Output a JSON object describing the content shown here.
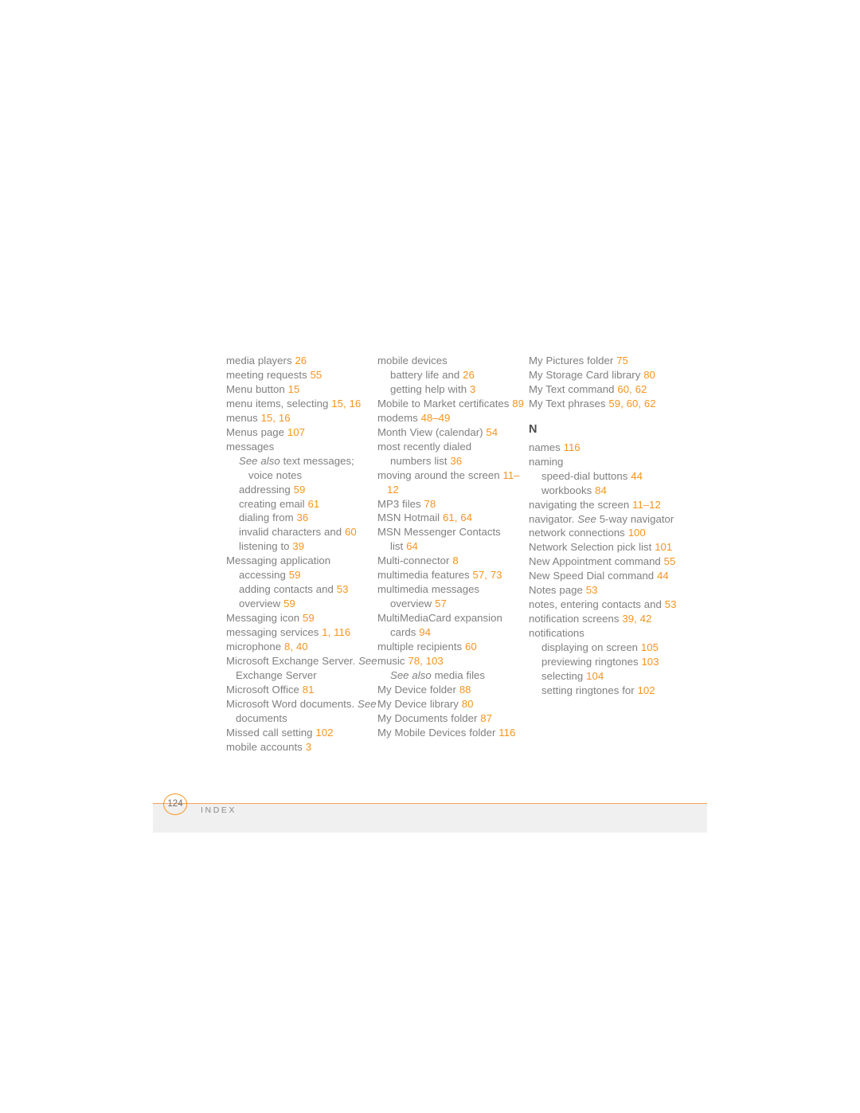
{
  "page": {
    "footer": {
      "page_number": "124",
      "section_label": "INDEX",
      "rule_color": "#F7A35C",
      "band_color": "#f0f0f0"
    },
    "colors": {
      "body_text": "#808080",
      "page_number_accent": "#F7941E",
      "heading": "#4d4d4d"
    }
  },
  "columns": [
    {
      "id": "column-1",
      "entries": [
        {
          "level": 0,
          "parts": [
            {
              "t": "media players ",
              "k": "text"
            },
            {
              "t": "26",
              "k": "num"
            }
          ]
        },
        {
          "level": 0,
          "parts": [
            {
              "t": "meeting requests ",
              "k": "text"
            },
            {
              "t": "55",
              "k": "num"
            }
          ]
        },
        {
          "level": 0,
          "parts": [
            {
              "t": "Menu button ",
              "k": "text"
            },
            {
              "t": "15",
              "k": "num"
            }
          ]
        },
        {
          "level": 0,
          "parts": [
            {
              "t": "menu items, selecting ",
              "k": "text"
            },
            {
              "t": "15, 16",
              "k": "num"
            }
          ]
        },
        {
          "level": 0,
          "parts": [
            {
              "t": "menus ",
              "k": "text"
            },
            {
              "t": "15, 16",
              "k": "num"
            }
          ]
        },
        {
          "level": 0,
          "parts": [
            {
              "t": "Menus page ",
              "k": "text"
            },
            {
              "t": "107",
              "k": "num"
            }
          ]
        },
        {
          "level": 0,
          "parts": [
            {
              "t": "messages",
              "k": "text"
            }
          ]
        },
        {
          "level": 1,
          "parts": [
            {
              "t": "See also",
              "k": "ital"
            },
            {
              "t": " text messages;",
              "k": "text"
            }
          ]
        },
        {
          "level": 2,
          "parts": [
            {
              "t": "voice notes",
              "k": "text"
            }
          ]
        },
        {
          "level": 1,
          "parts": [
            {
              "t": "addressing ",
              "k": "text"
            },
            {
              "t": "59",
              "k": "num"
            }
          ]
        },
        {
          "level": 1,
          "parts": [
            {
              "t": "creating email ",
              "k": "text"
            },
            {
              "t": "61",
              "k": "num"
            }
          ]
        },
        {
          "level": 1,
          "parts": [
            {
              "t": "dialing from ",
              "k": "text"
            },
            {
              "t": "36",
              "k": "num"
            }
          ]
        },
        {
          "level": 1,
          "parts": [
            {
              "t": "invalid characters and ",
              "k": "text"
            },
            {
              "t": "60",
              "k": "num"
            }
          ]
        },
        {
          "level": 1,
          "parts": [
            {
              "t": "listening to ",
              "k": "text"
            },
            {
              "t": "39",
              "k": "num"
            }
          ]
        },
        {
          "level": 0,
          "parts": [
            {
              "t": "Messaging application",
              "k": "text"
            }
          ]
        },
        {
          "level": 1,
          "parts": [
            {
              "t": "accessing ",
              "k": "text"
            },
            {
              "t": "59",
              "k": "num"
            }
          ]
        },
        {
          "level": 1,
          "parts": [
            {
              "t": "adding contacts and ",
              "k": "text"
            },
            {
              "t": "53",
              "k": "num"
            }
          ]
        },
        {
          "level": 1,
          "parts": [
            {
              "t": "overview ",
              "k": "text"
            },
            {
              "t": "59",
              "k": "num"
            }
          ]
        },
        {
          "level": 0,
          "parts": [
            {
              "t": "Messaging icon ",
              "k": "text"
            },
            {
              "t": "59",
              "k": "num"
            }
          ]
        },
        {
          "level": 0,
          "parts": [
            {
              "t": "messaging services ",
              "k": "text"
            },
            {
              "t": "1, 116",
              "k": "num"
            }
          ]
        },
        {
          "level": 0,
          "parts": [
            {
              "t": "microphone ",
              "k": "text"
            },
            {
              "t": "8, 40",
              "k": "num"
            }
          ]
        },
        {
          "level": 0,
          "parts": [
            {
              "t": "Microsoft Exchange Server. ",
              "k": "text"
            },
            {
              "t": "See",
              "k": "ital"
            },
            {
              "t": " Exchange Server",
              "k": "text"
            }
          ]
        },
        {
          "level": 0,
          "parts": [
            {
              "t": "Microsoft Office ",
              "k": "text"
            },
            {
              "t": "81",
              "k": "num"
            }
          ]
        },
        {
          "level": 0,
          "parts": [
            {
              "t": "Microsoft Word documents. ",
              "k": "text"
            },
            {
              "t": "See",
              "k": "ital"
            },
            {
              "t": " documents",
              "k": "text"
            }
          ]
        },
        {
          "level": 0,
          "parts": [
            {
              "t": "Missed call setting ",
              "k": "text"
            },
            {
              "t": "102",
              "k": "num"
            }
          ]
        },
        {
          "level": 0,
          "parts": [
            {
              "t": "mobile accounts ",
              "k": "text"
            },
            {
              "t": "3",
              "k": "num"
            }
          ]
        }
      ]
    },
    {
      "id": "column-2",
      "entries": [
        {
          "level": 0,
          "parts": [
            {
              "t": "mobile devices",
              "k": "text"
            }
          ]
        },
        {
          "level": 1,
          "parts": [
            {
              "t": "battery life and ",
              "k": "text"
            },
            {
              "t": "26",
              "k": "num"
            }
          ]
        },
        {
          "level": 1,
          "parts": [
            {
              "t": "getting help with ",
              "k": "text"
            },
            {
              "t": "3",
              "k": "num"
            }
          ]
        },
        {
          "level": 0,
          "parts": [
            {
              "t": "Mobile to Market certificates ",
              "k": "text"
            },
            {
              "t": "89",
              "k": "num"
            }
          ]
        },
        {
          "level": 0,
          "parts": [
            {
              "t": "modems ",
              "k": "text"
            },
            {
              "t": "48–49",
              "k": "num"
            }
          ]
        },
        {
          "level": 0,
          "parts": [
            {
              "t": "Month View (calendar) ",
              "k": "text"
            },
            {
              "t": "54",
              "k": "num"
            }
          ]
        },
        {
          "level": 0,
          "parts": [
            {
              "t": "most recently dialed",
              "k": "text"
            }
          ]
        },
        {
          "level": 1,
          "parts": [
            {
              "t": "numbers list ",
              "k": "text"
            },
            {
              "t": "36",
              "k": "num"
            }
          ]
        },
        {
          "level": 0,
          "parts": [
            {
              "t": "moving around the screen ",
              "k": "text"
            },
            {
              "t": "11–12",
              "k": "num"
            }
          ]
        },
        {
          "level": 0,
          "parts": [
            {
              "t": "MP3 files ",
              "k": "text"
            },
            {
              "t": "78",
              "k": "num"
            }
          ]
        },
        {
          "level": 0,
          "parts": [
            {
              "t": "MSN Hotmail ",
              "k": "text"
            },
            {
              "t": "61, 64",
              "k": "num"
            }
          ]
        },
        {
          "level": 0,
          "parts": [
            {
              "t": "MSN Messenger Contacts ",
              "k": "text"
            }
          ]
        },
        {
          "level": 1,
          "parts": [
            {
              "t": "list ",
              "k": "text"
            },
            {
              "t": "64",
              "k": "num"
            }
          ]
        },
        {
          "level": 0,
          "parts": [
            {
              "t": "Multi-connector ",
              "k": "text"
            },
            {
              "t": "8",
              "k": "num"
            }
          ]
        },
        {
          "level": 0,
          "parts": [
            {
              "t": "multimedia features ",
              "k": "text"
            },
            {
              "t": "57, 73",
              "k": "num"
            }
          ]
        },
        {
          "level": 0,
          "parts": [
            {
              "t": "multimedia messages",
              "k": "text"
            }
          ]
        },
        {
          "level": 1,
          "parts": [
            {
              "t": "overview ",
              "k": "text"
            },
            {
              "t": "57",
              "k": "num"
            }
          ]
        },
        {
          "level": 0,
          "parts": [
            {
              "t": "MultiMediaCard expansion",
              "k": "text"
            }
          ]
        },
        {
          "level": 1,
          "parts": [
            {
              "t": "cards ",
              "k": "text"
            },
            {
              "t": "94",
              "k": "num"
            }
          ]
        },
        {
          "level": 0,
          "parts": [
            {
              "t": "multiple recipients ",
              "k": "text"
            },
            {
              "t": "60",
              "k": "num"
            }
          ]
        },
        {
          "level": 0,
          "parts": [
            {
              "t": "music ",
              "k": "text"
            },
            {
              "t": "78, 103",
              "k": "num"
            }
          ]
        },
        {
          "level": 1,
          "parts": [
            {
              "t": "See also",
              "k": "ital"
            },
            {
              "t": " media files",
              "k": "text"
            }
          ]
        },
        {
          "level": 0,
          "parts": [
            {
              "t": "My Device folder ",
              "k": "text"
            },
            {
              "t": "88",
              "k": "num"
            }
          ]
        },
        {
          "level": 0,
          "parts": [
            {
              "t": "My Device library ",
              "k": "text"
            },
            {
              "t": "80",
              "k": "num"
            }
          ]
        },
        {
          "level": 0,
          "parts": [
            {
              "t": "My Documents folder ",
              "k": "text"
            },
            {
              "t": "87",
              "k": "num"
            }
          ]
        },
        {
          "level": 0,
          "parts": [
            {
              "t": "My Mobile Devices folder ",
              "k": "text"
            },
            {
              "t": "116",
              "k": "num"
            }
          ]
        }
      ]
    },
    {
      "id": "column-3",
      "entries": [
        {
          "level": 0,
          "parts": [
            {
              "t": "My Pictures folder ",
              "k": "text"
            },
            {
              "t": "75",
              "k": "num"
            }
          ]
        },
        {
          "level": 0,
          "parts": [
            {
              "t": "My Storage Card library ",
              "k": "text"
            },
            {
              "t": "80",
              "k": "num"
            }
          ]
        },
        {
          "level": 0,
          "parts": [
            {
              "t": "My Text command ",
              "k": "text"
            },
            {
              "t": "60, 62",
              "k": "num"
            }
          ]
        },
        {
          "level": 0,
          "parts": [
            {
              "t": "My Text phrases ",
              "k": "text"
            },
            {
              "t": "59, 60, 62",
              "k": "num"
            }
          ]
        },
        {
          "letter": "N"
        },
        {
          "level": 0,
          "parts": [
            {
              "t": "names ",
              "k": "text"
            },
            {
              "t": "116",
              "k": "num"
            }
          ]
        },
        {
          "level": 0,
          "parts": [
            {
              "t": "naming",
              "k": "text"
            }
          ]
        },
        {
          "level": 1,
          "parts": [
            {
              "t": "speed-dial buttons ",
              "k": "text"
            },
            {
              "t": "44",
              "k": "num"
            }
          ]
        },
        {
          "level": 1,
          "parts": [
            {
              "t": "workbooks ",
              "k": "text"
            },
            {
              "t": "84",
              "k": "num"
            }
          ]
        },
        {
          "level": 0,
          "parts": [
            {
              "t": "navigating the screen ",
              "k": "text"
            },
            {
              "t": "11–12",
              "k": "num"
            }
          ]
        },
        {
          "level": 0,
          "parts": [
            {
              "t": "navigator. ",
              "k": "text"
            },
            {
              "t": "See",
              "k": "ital"
            },
            {
              "t": " 5-way navigator",
              "k": "text"
            }
          ]
        },
        {
          "level": 0,
          "parts": [
            {
              "t": "network connections ",
              "k": "text"
            },
            {
              "t": "100",
              "k": "num"
            }
          ]
        },
        {
          "level": 0,
          "parts": [
            {
              "t": "Network Selection pick list ",
              "k": "text"
            },
            {
              "t": "101",
              "k": "num"
            }
          ]
        },
        {
          "level": 0,
          "parts": [
            {
              "t": "New Appointment command ",
              "k": "text"
            },
            {
              "t": "55",
              "k": "num"
            }
          ]
        },
        {
          "level": 0,
          "parts": [
            {
              "t": "New Speed Dial command ",
              "k": "text"
            },
            {
              "t": "44",
              "k": "num"
            }
          ]
        },
        {
          "level": 0,
          "parts": [
            {
              "t": "Notes page ",
              "k": "text"
            },
            {
              "t": "53",
              "k": "num"
            }
          ]
        },
        {
          "level": 0,
          "parts": [
            {
              "t": "notes, entering contacts and ",
              "k": "text"
            },
            {
              "t": "53",
              "k": "num"
            }
          ]
        },
        {
          "level": 0,
          "parts": [
            {
              "t": "notification screens ",
              "k": "text"
            },
            {
              "t": "39, 42",
              "k": "num"
            }
          ]
        },
        {
          "level": 0,
          "parts": [
            {
              "t": "notifications",
              "k": "text"
            }
          ]
        },
        {
          "level": 1,
          "parts": [
            {
              "t": "displaying on screen ",
              "k": "text"
            },
            {
              "t": "105",
              "k": "num"
            }
          ]
        },
        {
          "level": 1,
          "parts": [
            {
              "t": "previewing ringtones ",
              "k": "text"
            },
            {
              "t": "103",
              "k": "num"
            }
          ]
        },
        {
          "level": 1,
          "parts": [
            {
              "t": "selecting ",
              "k": "text"
            },
            {
              "t": "104",
              "k": "num"
            }
          ]
        },
        {
          "level": 1,
          "parts": [
            {
              "t": "setting ringtones for ",
              "k": "text"
            },
            {
              "t": "102",
              "k": "num"
            }
          ]
        }
      ]
    }
  ]
}
